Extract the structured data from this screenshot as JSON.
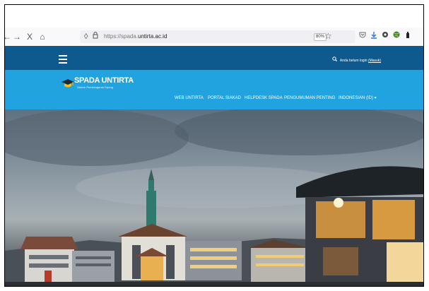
{
  "browser": {
    "back_icon": "←",
    "forward_icon": "→",
    "close_icon": "X",
    "home_icon": "⌂",
    "shield_icon": "◊",
    "lock_icon": "🔒",
    "url_prefix": "https://spada.",
    "url_domain": "untirta.ac.id",
    "zoom": "80%",
    "star_icon": "☆"
  },
  "topbar": {
    "login_text": "Anda belum login",
    "login_link": "(Masuk)"
  },
  "site": {
    "logo_title": "SPADA UNTIRTA",
    "logo_subtitle": "Sistem Pembelajaran Daring"
  },
  "nav": {
    "items": [
      "WEB UNTIRTA",
      "PORTAL SIAKAD",
      "HELPDESK SPADA",
      "PENGUMUMAN PENTING",
      "INDONESIAN (ID) ▾"
    ]
  },
  "colors": {
    "topbar": "#0e5a8f",
    "navband": "#21a3df"
  }
}
